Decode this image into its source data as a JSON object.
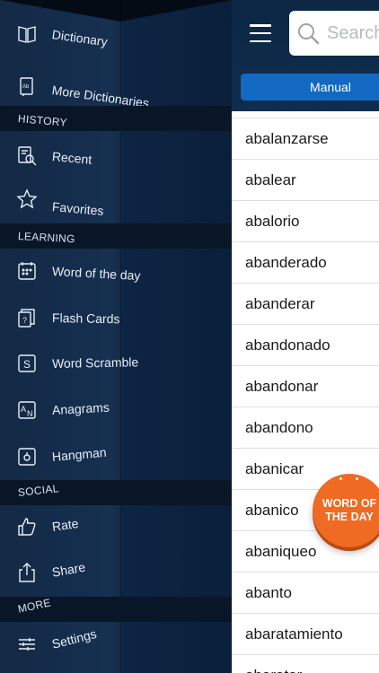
{
  "sidebar": {
    "items_top": [
      {
        "label": "Dictionary",
        "icon": "book-icon"
      },
      {
        "label": "More Dictionaries",
        "icon": "dictionary-stack-icon"
      }
    ],
    "sections": [
      {
        "title": "HISTORY"
      },
      {
        "title": "LEARNING"
      },
      {
        "title": "SOCIAL"
      },
      {
        "title": "MORE"
      }
    ],
    "history_items": [
      {
        "label": "Recent",
        "icon": "recent-search-icon"
      },
      {
        "label": "Favorites",
        "icon": "star-icon"
      }
    ],
    "learning_items": [
      {
        "label": "Word of the day",
        "icon": "calendar-icon"
      },
      {
        "label": "Flash Cards",
        "icon": "flash-cards-icon"
      },
      {
        "label": "Word Scramble",
        "icon": "word-scramble-icon"
      },
      {
        "label": "Anagrams",
        "icon": "anagrams-icon"
      },
      {
        "label": "Hangman",
        "icon": "hangman-icon"
      }
    ],
    "social_items": [
      {
        "label": "Rate",
        "icon": "thumbs-up-icon"
      },
      {
        "label": "Share",
        "icon": "share-icon"
      }
    ],
    "more_items": [
      {
        "label": "Settings",
        "icon": "settings-sliders-icon"
      }
    ]
  },
  "header": {
    "search_placeholder": "Search",
    "manual_label": "Manual"
  },
  "words": [
    "",
    "abalanzarse",
    "abalear",
    "abalorio",
    "abanderado",
    "abanderar",
    "abandonado",
    "abandonar",
    "abandono",
    "abanicar",
    "abanico",
    "abaniqueo",
    "abanto",
    "abaratamiento",
    "abaratar"
  ],
  "badge": {
    "line1": "WORD OF",
    "line2": "THE DAY",
    "color": "#ef6a22"
  },
  "colors": {
    "sidebar_bg": "#0f2a4c",
    "accent_blue": "#1369c2"
  }
}
